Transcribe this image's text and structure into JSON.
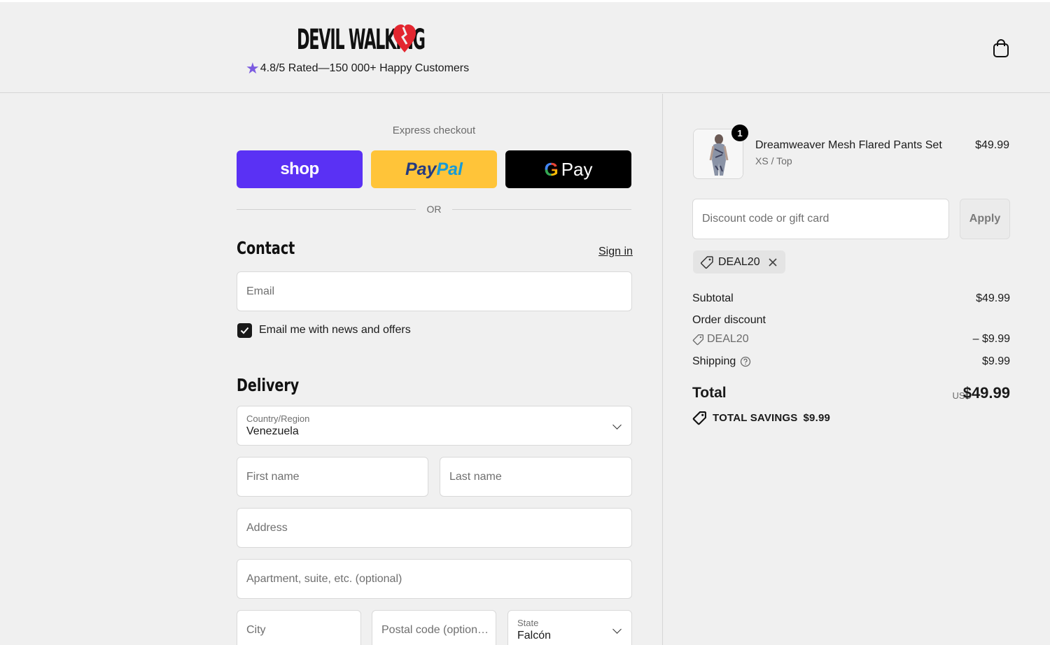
{
  "header": {
    "brand": "DEVIL WALKING",
    "rating_text": "4.8/5 Rated—150 000+ Happy Customers",
    "cart_icon": "shopping-bag-icon"
  },
  "express": {
    "label": "Express checkout",
    "shop_label": "shop",
    "paypal_label_1": "Pay",
    "paypal_label_2": "Pal",
    "gpay_g": "G",
    "gpay_label": "Pay",
    "or_text": "OR"
  },
  "contact": {
    "title": "Contact",
    "sign_in": "Sign in",
    "email_placeholder": "Email",
    "newsletter_label": "Email me with news and offers",
    "newsletter_checked": true
  },
  "delivery": {
    "title": "Delivery",
    "country_label": "Country/Region",
    "country_value": "Venezuela",
    "first_name_placeholder": "First name",
    "last_name_placeholder": "Last name",
    "address_placeholder": "Address",
    "apartment_placeholder": "Apartment, suite, etc. (optional)",
    "city_placeholder": "City",
    "postal_placeholder": "Postal code (option…",
    "state_label": "State",
    "state_value": "Falcón"
  },
  "summary": {
    "product": {
      "name": "Dreamweaver Mesh Flared Pants Set",
      "variant": "XS / Top",
      "price": "$49.99",
      "quantity": "1"
    },
    "discount_placeholder": "Discount code or gift card",
    "apply_label": "Apply",
    "applied_code": "DEAL20",
    "subtotal_label": "Subtotal",
    "subtotal_value": "$49.99",
    "order_discount_label": "Order discount",
    "discount_code": "DEAL20",
    "discount_value": "– $9.99",
    "shipping_label": "Shipping",
    "shipping_value": "$9.99",
    "total_label": "Total",
    "currency": "USD",
    "total_value": "$49.99",
    "savings_label": "TOTAL SAVINGS",
    "savings_value": "$9.99"
  },
  "colors": {
    "shop_pay": "#5a31f4",
    "paypal": "#ffc439",
    "gpay": "#000000",
    "rating_star": "#7b5be0",
    "brand_heart": "#e3262f"
  }
}
